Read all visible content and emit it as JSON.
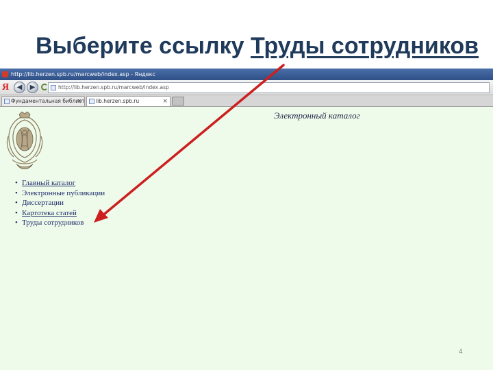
{
  "slide": {
    "title_prefix": "Выберите ссылку ",
    "title_link": "Труды сотрудников",
    "page_number": "4"
  },
  "browser": {
    "window_title": "http://lib.herzen.spb.ru/marcweb/index.asp - Яндекс",
    "address": "http://lib.herzen.spb.ru/marcweb/index.asp",
    "yandex_logo": "Я",
    "tabs": [
      {
        "label": "Фундаментальная библиотек...",
        "close": "×",
        "active": false
      },
      {
        "label": "lib.herzen.spb.ru",
        "close": "×",
        "active": true
      }
    ]
  },
  "page": {
    "heading": "Электронный каталог",
    "menu": [
      {
        "label": "Главный каталог",
        "underlined": true
      },
      {
        "label": "Электронные публикации",
        "underlined": false
      },
      {
        "label": "Диссертации",
        "underlined": false
      },
      {
        "label": "Картотека статей",
        "underlined": true
      },
      {
        "label": "Труды сотрудников",
        "underlined": false
      }
    ]
  },
  "colors": {
    "title": "#1f3a5a",
    "arrow": "#cc1f1f",
    "page_background": "#eefbea",
    "link": "#1d2a6a",
    "emblem": "#8a7a5c"
  },
  "icons": [
    "app-icon",
    "back-icon",
    "forward-icon",
    "refresh-icon",
    "page-icon",
    "tab-close-icon",
    "university-emblem",
    "arrow"
  ]
}
